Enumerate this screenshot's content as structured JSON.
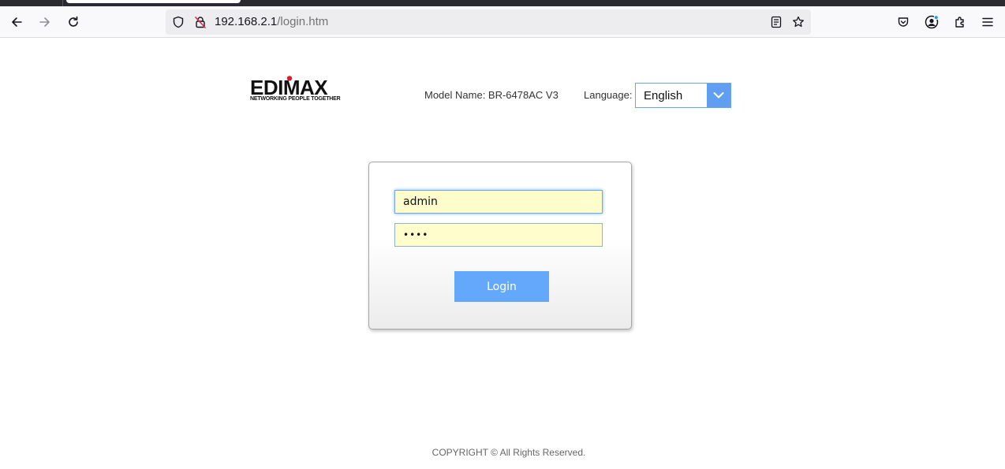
{
  "browser": {
    "url_host": "192.168.2.1",
    "url_path": "/login.htm",
    "icons": [
      "back-arrow-icon",
      "forward-arrow-icon",
      "reload-icon",
      "shield-icon",
      "lock-insecure-icon",
      "reader-view-icon",
      "bookmark-star-icon",
      "pocket-icon",
      "account-icon",
      "extensions-icon",
      "menu-icon"
    ]
  },
  "header": {
    "logo_text": "EDIMAX",
    "logo_tagline": "NETWORKING PEOPLE TOGETHER",
    "model_name": "Model Name: BR-6478AC V3",
    "language_label": "Language:",
    "language_value": "English"
  },
  "login": {
    "username": "admin",
    "password_mask": "••••",
    "button_label": "Login"
  },
  "footer": {
    "copyright": "COPYRIGHT © All Rights Reserved."
  },
  "colors": {
    "accent": "#64a8fb",
    "select_arrow_bg": "#5f9ef0",
    "field_bg": "#fffdcc",
    "logo_red": "#d81e28"
  }
}
